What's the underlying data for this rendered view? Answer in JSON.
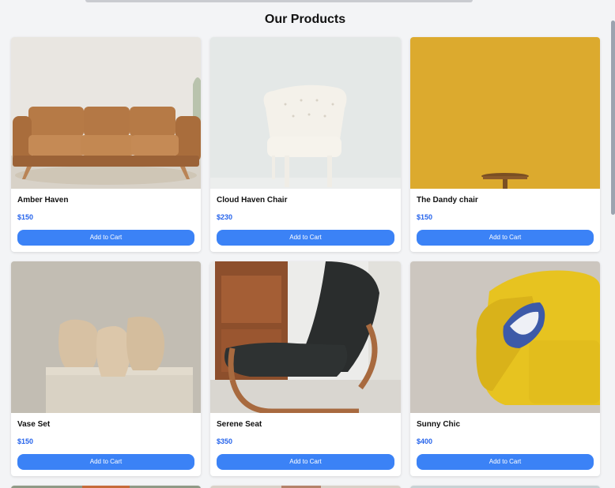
{
  "page": {
    "title": "Our Products"
  },
  "products": [
    {
      "name": "Amber Haven",
      "price": "$150",
      "cta": "Add to Cart"
    },
    {
      "name": "Cloud Haven Chair",
      "price": "$230",
      "cta": "Add to Cart"
    },
    {
      "name": "The Dandy chair",
      "price": "$150",
      "cta": "Add to Cart"
    },
    {
      "name": "Vase Set",
      "price": "$150",
      "cta": "Add to Cart"
    },
    {
      "name": "Serene Seat",
      "price": "$350",
      "cta": "Add to Cart"
    },
    {
      "name": "Sunny Chic",
      "price": "$400",
      "cta": "Add to Cart"
    }
  ],
  "colors": {
    "accent": "#3b82f6",
    "price": "#2563eb",
    "background": "#f3f4f6"
  }
}
